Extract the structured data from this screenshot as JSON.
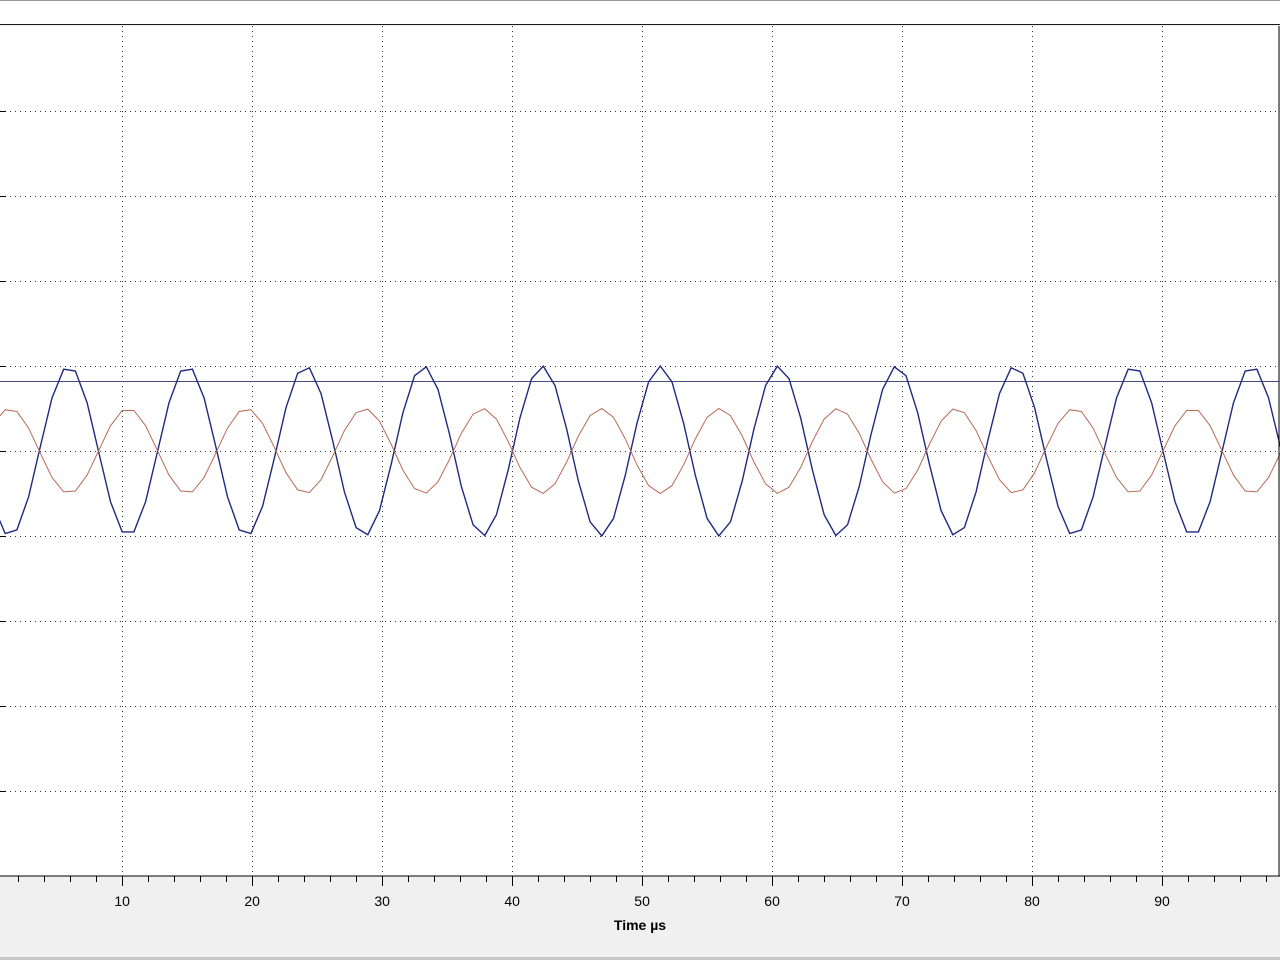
{
  "chart_data": {
    "type": "line",
    "xlabel": "Time µs",
    "ylabel": "",
    "title": "",
    "xlim": [
      0.6,
      99
    ],
    "ylim": [
      -5,
      5
    ],
    "x_ticks": [
      10,
      20,
      30,
      40,
      50,
      60,
      70,
      80,
      90
    ],
    "x_minor_step": 2,
    "y_gridlines": [
      -4,
      -3,
      -2,
      -1,
      0,
      1,
      2,
      3,
      4
    ],
    "grid": true,
    "reference_line_y": 0.82,
    "series": [
      {
        "color": "#1f2a80",
        "amplitude": 1.0,
        "period": 9.1,
        "peak_x": 5.9,
        "x_step": 0.9,
        "offset": 0.0
      },
      {
        "color": "#b86a55",
        "amplitude": 0.5,
        "period": 9.1,
        "peak_x": 10.45,
        "x_step": 0.9,
        "offset": 0.0
      }
    ]
  },
  "colors": {
    "background": "#ffffff",
    "frame": "#f0f0f0",
    "grid": "#303030",
    "reference_line": "#4a4f7a"
  }
}
